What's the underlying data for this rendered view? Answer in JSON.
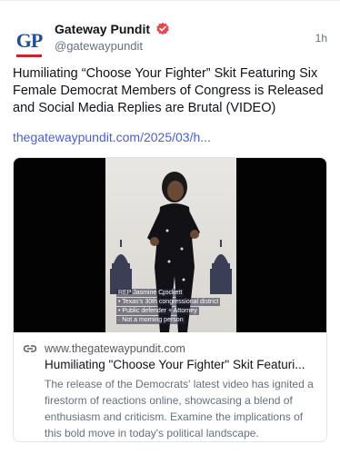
{
  "post": {
    "author_name": "Gateway Pundit",
    "author_handle": "@gatewaypundit",
    "avatar_text": "GP",
    "time": "1h",
    "text": "Humiliating “Choose Your Fighter” Skit Featuring Six Female Democrat Members of Congress is Released and Social Media Replies are Brutal (VIDEO)",
    "link_text": "thegatewaypundit.com/2025/03/h..."
  },
  "card": {
    "domain": "www.thegatewaypundit.com",
    "title": "Humiliating \"Choose Your Fighter\" Skit Featuri...",
    "description": "The release of the Democrats' latest video has ignited a firestorm of reactions online, showcasing a blend of enthusiasm and criticism. Examine the implications of this bold move in today's political landscape.",
    "caption_lines": [
      "REP Jasmine Crockett",
      "• Texas's 30th congressional district",
      "• Public defender + Attorney",
      "· Not a morning person"
    ]
  },
  "colors": {
    "link": "#4a5ed8",
    "badge": "#e8454f",
    "avatar_blue": "#1c4e9b",
    "avatar_red": "#c8262f"
  },
  "icons": {
    "verified": "verified-badge-icon",
    "link": "link-icon"
  }
}
